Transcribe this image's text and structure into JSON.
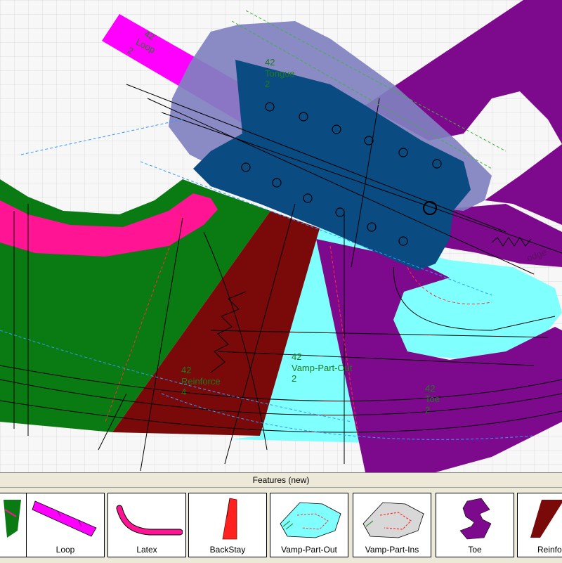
{
  "panel": {
    "title": "Features (new)"
  },
  "canvas_labels": {
    "loop": {
      "size": "42",
      "name": "Loop",
      "qty": "2"
    },
    "tongue": {
      "size": "42",
      "name": "Tongue",
      "qty": "2"
    },
    "reinforce": {
      "size": "42",
      "name": "Reinforce",
      "qty": "4"
    },
    "vamp_out": {
      "size": "42",
      "name": "Vamp-Part-Out",
      "qty": "2"
    },
    "toe": {
      "size": "42",
      "name": "Toe",
      "qty": "2"
    },
    "edge_text": "odge"
  },
  "features": [
    {
      "label": "",
      "icon": "green-quarter-icon"
    },
    {
      "label": "Loop",
      "icon": "loop-strip-icon"
    },
    {
      "label": "Latex",
      "icon": "latex-curve-icon"
    },
    {
      "label": "BackStay",
      "icon": "backstay-icon"
    },
    {
      "label": "Vamp-Part-Out",
      "icon": "vamp-out-icon"
    },
    {
      "label": "Vamp-Part-Ins",
      "icon": "vamp-ins-icon"
    },
    {
      "label": "Toe",
      "icon": "toe-icon"
    },
    {
      "label": "Reinfor",
      "icon": "reinforce-icon"
    }
  ],
  "colors": {
    "grid": "#dcdcdc",
    "green": "#0a7a12",
    "pink": "#ff1493",
    "magenta": "#ff00ff",
    "maroon": "#7a0a0a",
    "cyan": "#80ffff",
    "purple": "#7d0a8c",
    "lavender": "#8080c0",
    "navy": "#0a4b82"
  }
}
